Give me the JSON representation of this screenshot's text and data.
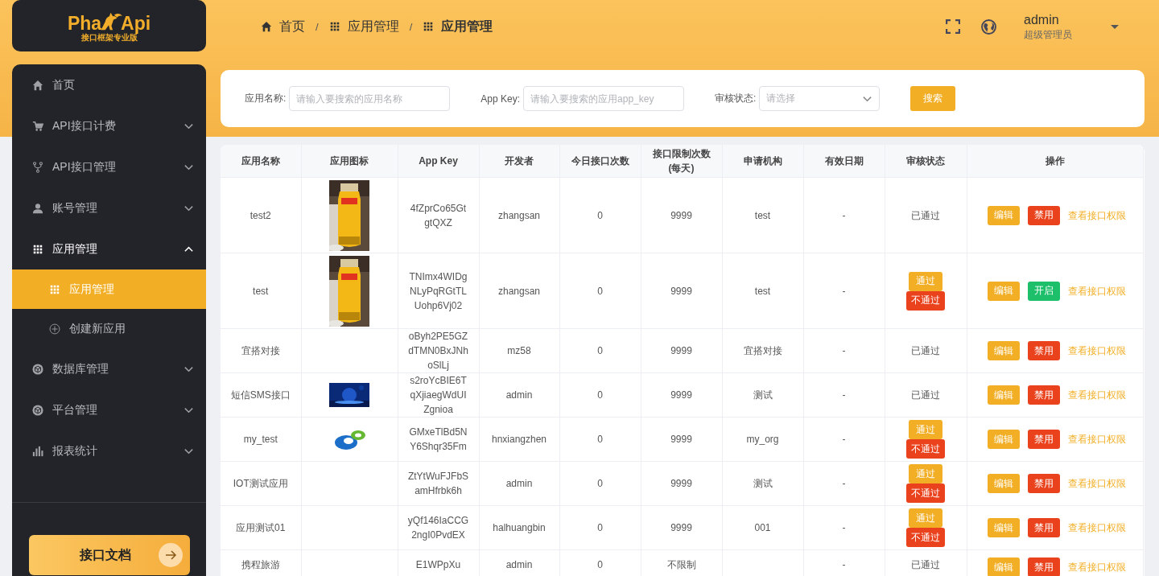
{
  "logo": {
    "left": "Pha",
    "right": "Api",
    "subtitle": "接口框架专业版"
  },
  "breadcrumb": {
    "separator": "/",
    "items": [
      {
        "label": "首页",
        "kind": "home"
      },
      {
        "label": "应用管理",
        "kind": "apps"
      },
      {
        "label": "应用管理",
        "kind": "apps"
      }
    ]
  },
  "user": {
    "name": "admin",
    "role": "超级管理员"
  },
  "sidebar": {
    "items": [
      {
        "label": "首页",
        "kind": "home"
      },
      {
        "label": "API接口计费",
        "kind": "billing",
        "expanded": false
      },
      {
        "label": "API接口管理",
        "kind": "api",
        "expanded": false
      },
      {
        "label": "账号管理",
        "kind": "account",
        "expanded": false
      },
      {
        "label": "应用管理",
        "kind": "apps",
        "expanded": true,
        "children": [
          {
            "label": "应用管理",
            "kind": "apps",
            "selected": true
          },
          {
            "label": "创建新应用",
            "kind": "create",
            "selected": false
          }
        ]
      },
      {
        "label": "数据库管理",
        "kind": "database",
        "expanded": false
      },
      {
        "label": "平台管理",
        "kind": "platform",
        "expanded": false
      },
      {
        "label": "报表统计",
        "kind": "report",
        "expanded": false
      }
    ],
    "doc_button": "接口文档"
  },
  "search": {
    "fields": [
      {
        "label": "应用名称:",
        "placeholder": "请输入要搜索的应用名称",
        "kind": "input"
      },
      {
        "label": "App Key:",
        "placeholder": "请输入要搜索的应用app_key",
        "kind": "input"
      },
      {
        "label": "审核状态:",
        "placeholder": "请选择",
        "kind": "select"
      }
    ],
    "button": "搜索"
  },
  "table": {
    "columns": [
      "应用名称",
      "应用图标",
      "App Key",
      "开发者",
      "今日接口次数",
      "接口限制次数(每天)",
      "申请机构",
      "有效日期",
      "审核状态",
      "操作"
    ],
    "rows": [
      {
        "name": "test2",
        "app_key": "4fZprCo65GtgtQXZ",
        "developer": "zhangsan",
        "today": "0",
        "limit": "9999",
        "org": "test",
        "valid": "-",
        "review": {
          "kind": "done",
          "text": "已通过"
        },
        "edit": "编辑",
        "toggle": {
          "kind": "disable",
          "label": "禁用"
        },
        "perm": "查看接口权限"
      },
      {
        "name": "test",
        "app_key": "TNImx4WIDgNLyPqRGtTLUohp6Vj02",
        "developer": "zhangsan",
        "today": "0",
        "limit": "9999",
        "org": "test",
        "valid": "-",
        "review": {
          "kind": "pending",
          "pass": "通过",
          "reject": "不通过"
        },
        "edit": "编辑",
        "toggle": {
          "kind": "enable",
          "label": "开启"
        },
        "perm": "查看接口权限"
      },
      {
        "name": "宜搭对接",
        "app_key": "oByh2PE5GZdTMN0BxJNhoSlLj",
        "developer": "mz58",
        "today": "0",
        "limit": "9999",
        "org": "宜搭对接",
        "valid": "-",
        "review": {
          "kind": "done",
          "text": "已通过"
        },
        "edit": "编辑",
        "toggle": {
          "kind": "disable",
          "label": "禁用"
        },
        "perm": "查看接口权限"
      },
      {
        "name": "短信SMS接口",
        "app_key": "s2roYcBIE6TqXjiaegWdUIZgnioa",
        "developer": "admin",
        "today": "0",
        "limit": "9999",
        "org": "测试",
        "valid": "-",
        "review": {
          "kind": "done",
          "text": "已通过"
        },
        "edit": "编辑",
        "toggle": {
          "kind": "disable",
          "label": "禁用"
        },
        "perm": "查看接口权限"
      },
      {
        "name": "my_test",
        "image": {
          "kind": "logo"
        },
        "app_key": "GMxeTlBd5NY6Shqr35Fm",
        "developer": "hnxiangzhen",
        "today": "0",
        "limit": "9999",
        "org": "my_org",
        "valid": "-",
        "review": {
          "kind": "pending",
          "pass": "通过",
          "reject": "不通过"
        },
        "edit": "编辑",
        "toggle": {
          "kind": "disable",
          "label": "禁用"
        },
        "perm": "查看接口权限"
      },
      {
        "name": "IOT测试应用",
        "app_key": "ZtYtWuFJFbSamHfrbk6h",
        "developer": "admin",
        "today": "0",
        "limit": "9999",
        "org": "测试",
        "valid": "-",
        "review": {
          "kind": "pending",
          "pass": "通过",
          "reject": "不通过"
        },
        "edit": "编辑",
        "toggle": {
          "kind": "disable",
          "label": "禁用"
        },
        "perm": "查看接口权限"
      },
      {
        "name": "应用测试01",
        "app_key": "yQf146IaCCG2ngI0PvdEX",
        "developer": "halhuangbin",
        "today": "0",
        "limit": "9999",
        "org": "001",
        "valid": "-",
        "review": {
          "kind": "pending",
          "pass": "通过",
          "reject": "不通过"
        },
        "edit": "编辑",
        "toggle": {
          "kind": "disable",
          "label": "禁用"
        },
        "perm": "查看接口权限"
      },
      {
        "name": "携程旅游",
        "app_key": "E1WPpXu",
        "developer": "admin",
        "today": "0",
        "limit": "不限制",
        "valid": "-",
        "review": {
          "kind": "done",
          "text": "已通过"
        },
        "edit": "编辑",
        "toggle": {
          "kind": "disable",
          "label": "禁用"
        },
        "perm": "查看接口权限"
      }
    ]
  }
}
